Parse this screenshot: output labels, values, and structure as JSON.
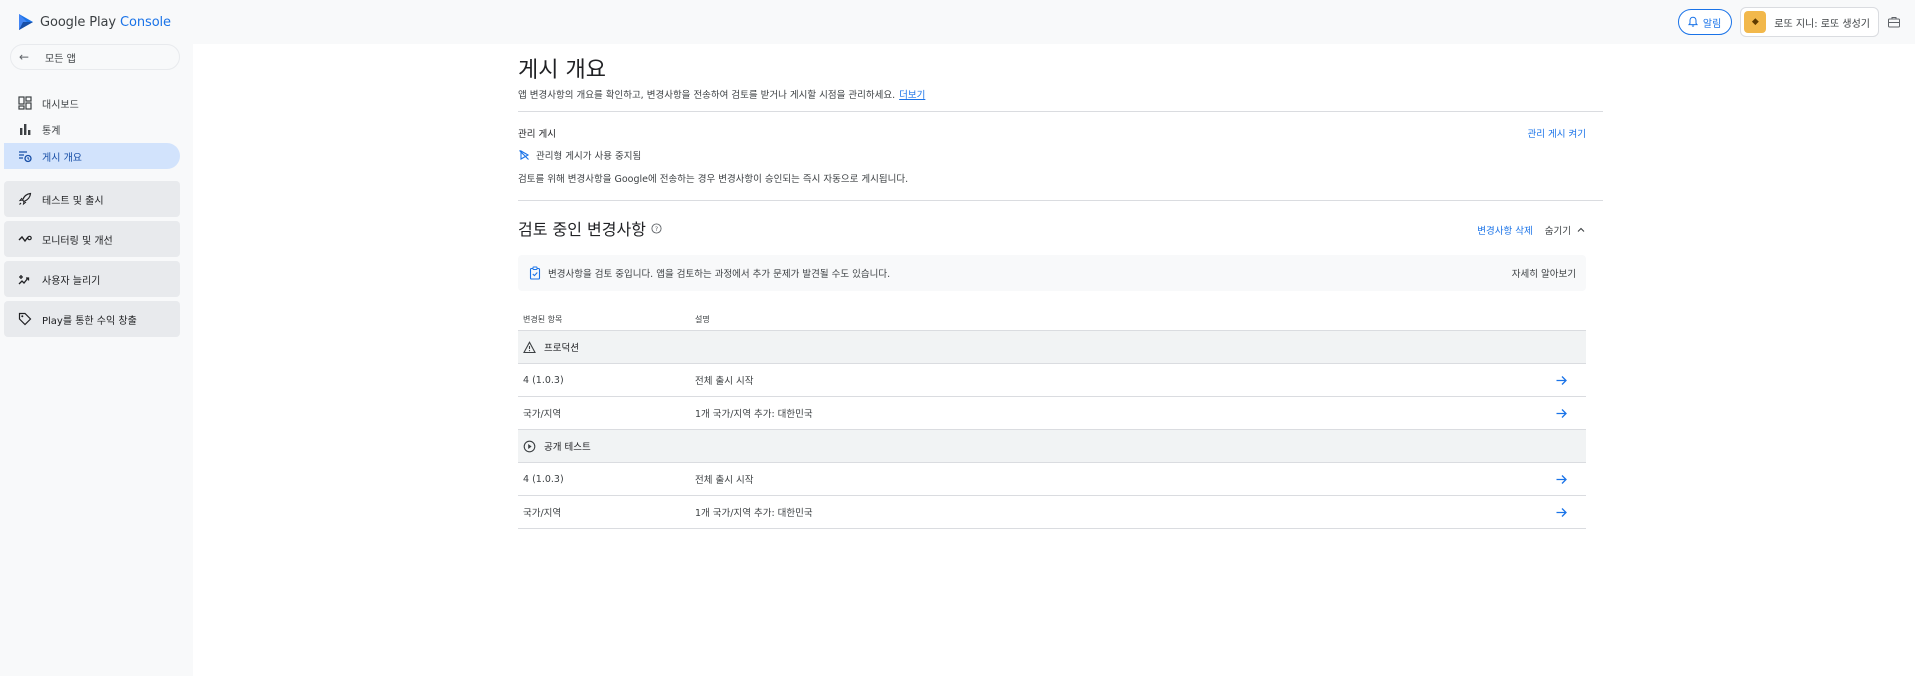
{
  "header": {
    "logo_brand": "Google Play",
    "logo_accent": "Console",
    "notify_label": "알림",
    "account_label": "로또 지니: 로또 생성기"
  },
  "sidebar": {
    "back_label": "모든 앱",
    "items": [
      {
        "label": "대시보드",
        "icon": "dashboard-icon"
      },
      {
        "label": "통계",
        "icon": "bar-chart-icon"
      },
      {
        "label": "게시 개요",
        "icon": "publishing-overview-icon",
        "active": true
      }
    ],
    "groups": [
      {
        "label": "테스트 및 출시",
        "icon": "rocket-icon"
      },
      {
        "label": "모니터링 및 개선",
        "icon": "trend-icon"
      },
      {
        "label": "사용자 늘리기",
        "icon": "grow-users-icon"
      },
      {
        "label": "Play를 통한 수익 창출",
        "icon": "tag-icon"
      }
    ]
  },
  "main": {
    "title": "게시 개요",
    "description": "앱 변경사항의 개요를 확인하고, 변경사항을 전송하여 검토를 받거나 게시할 시점을 관리하세요.",
    "learn_more": "더보기",
    "managed": {
      "label": "관리 게시",
      "enable_link": "관리 게시 켜기",
      "status": "관리형 게시가 사용 중지됨",
      "note": "검토를 위해 변경사항을 Google에 전송하는 경우 변경사항이 승인되는 즉시 자동으로 게시됩니다."
    },
    "review": {
      "title": "검토 중인 변경사항",
      "delete_link": "변경사항 삭제",
      "hide_label": "숨기기",
      "notice": "변경사항을 검토 중입니다. 앱을 검토하는 과정에서 추가 문제가 발견될 수도 있습니다.",
      "notice_link": "자세히 알아보기"
    },
    "table": {
      "headers": [
        "변경된 항목",
        "설명"
      ],
      "groups": [
        {
          "name": "프로덕션",
          "icon": "warning-triangle-icon",
          "rows": [
            {
              "item": "4 (1.0.3)",
              "desc": "전체 출시 시작"
            },
            {
              "item": "국가/지역",
              "desc": "1개 국가/지역 추가: 대한민국"
            }
          ]
        },
        {
          "name": "공개 테스트",
          "icon": "open-testing-icon",
          "rows": [
            {
              "item": "4 (1.0.3)",
              "desc": "전체 출시 시작"
            },
            {
              "item": "국가/지역",
              "desc": "1개 국가/지역 추가: 대한민국"
            }
          ]
        }
      ]
    }
  },
  "colors": {
    "accent": "#1a73e8",
    "active_nav_bg": "#d2e3fc",
    "sidebar_bg": "#f8f9fa"
  }
}
